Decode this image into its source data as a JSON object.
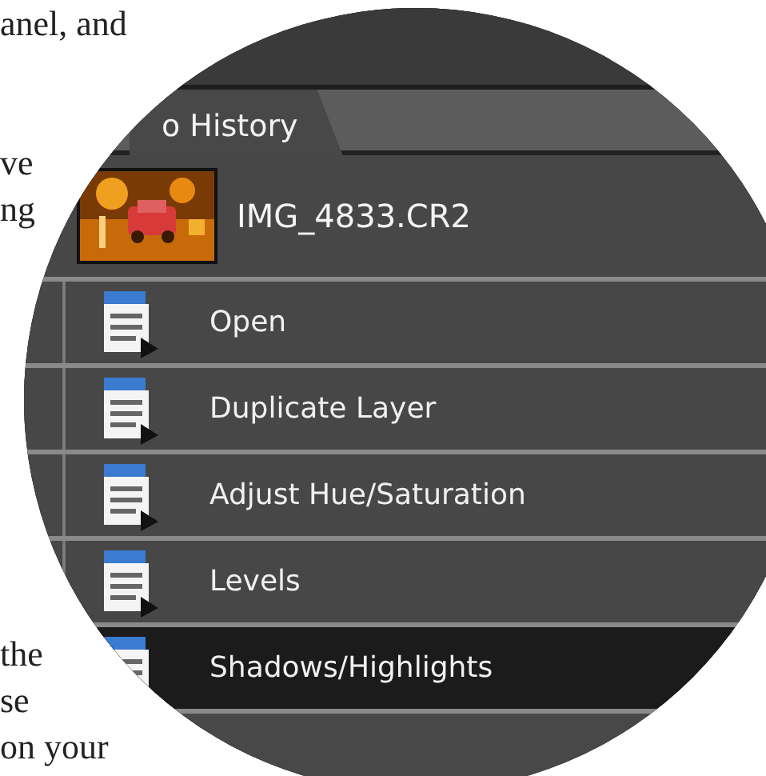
{
  "page_text": {
    "top": [
      "anel, and"
    ],
    "middle": [
      "ve",
      "ng"
    ],
    "bottom": [
      "the",
      "se",
      "on your"
    ]
  },
  "history_panel": {
    "tab": {
      "label": "o History",
      "selected": true
    },
    "snapshot": {
      "name": "IMG_4833.CR2"
    },
    "steps": [
      {
        "label": "Open",
        "selected": false
      },
      {
        "label": "Duplicate Layer",
        "selected": false
      },
      {
        "label": "Adjust Hue/Saturation",
        "selected": false
      },
      {
        "label": "Levels",
        "selected": false
      },
      {
        "label": "Shadows/Highlights",
        "selected": true
      }
    ]
  }
}
